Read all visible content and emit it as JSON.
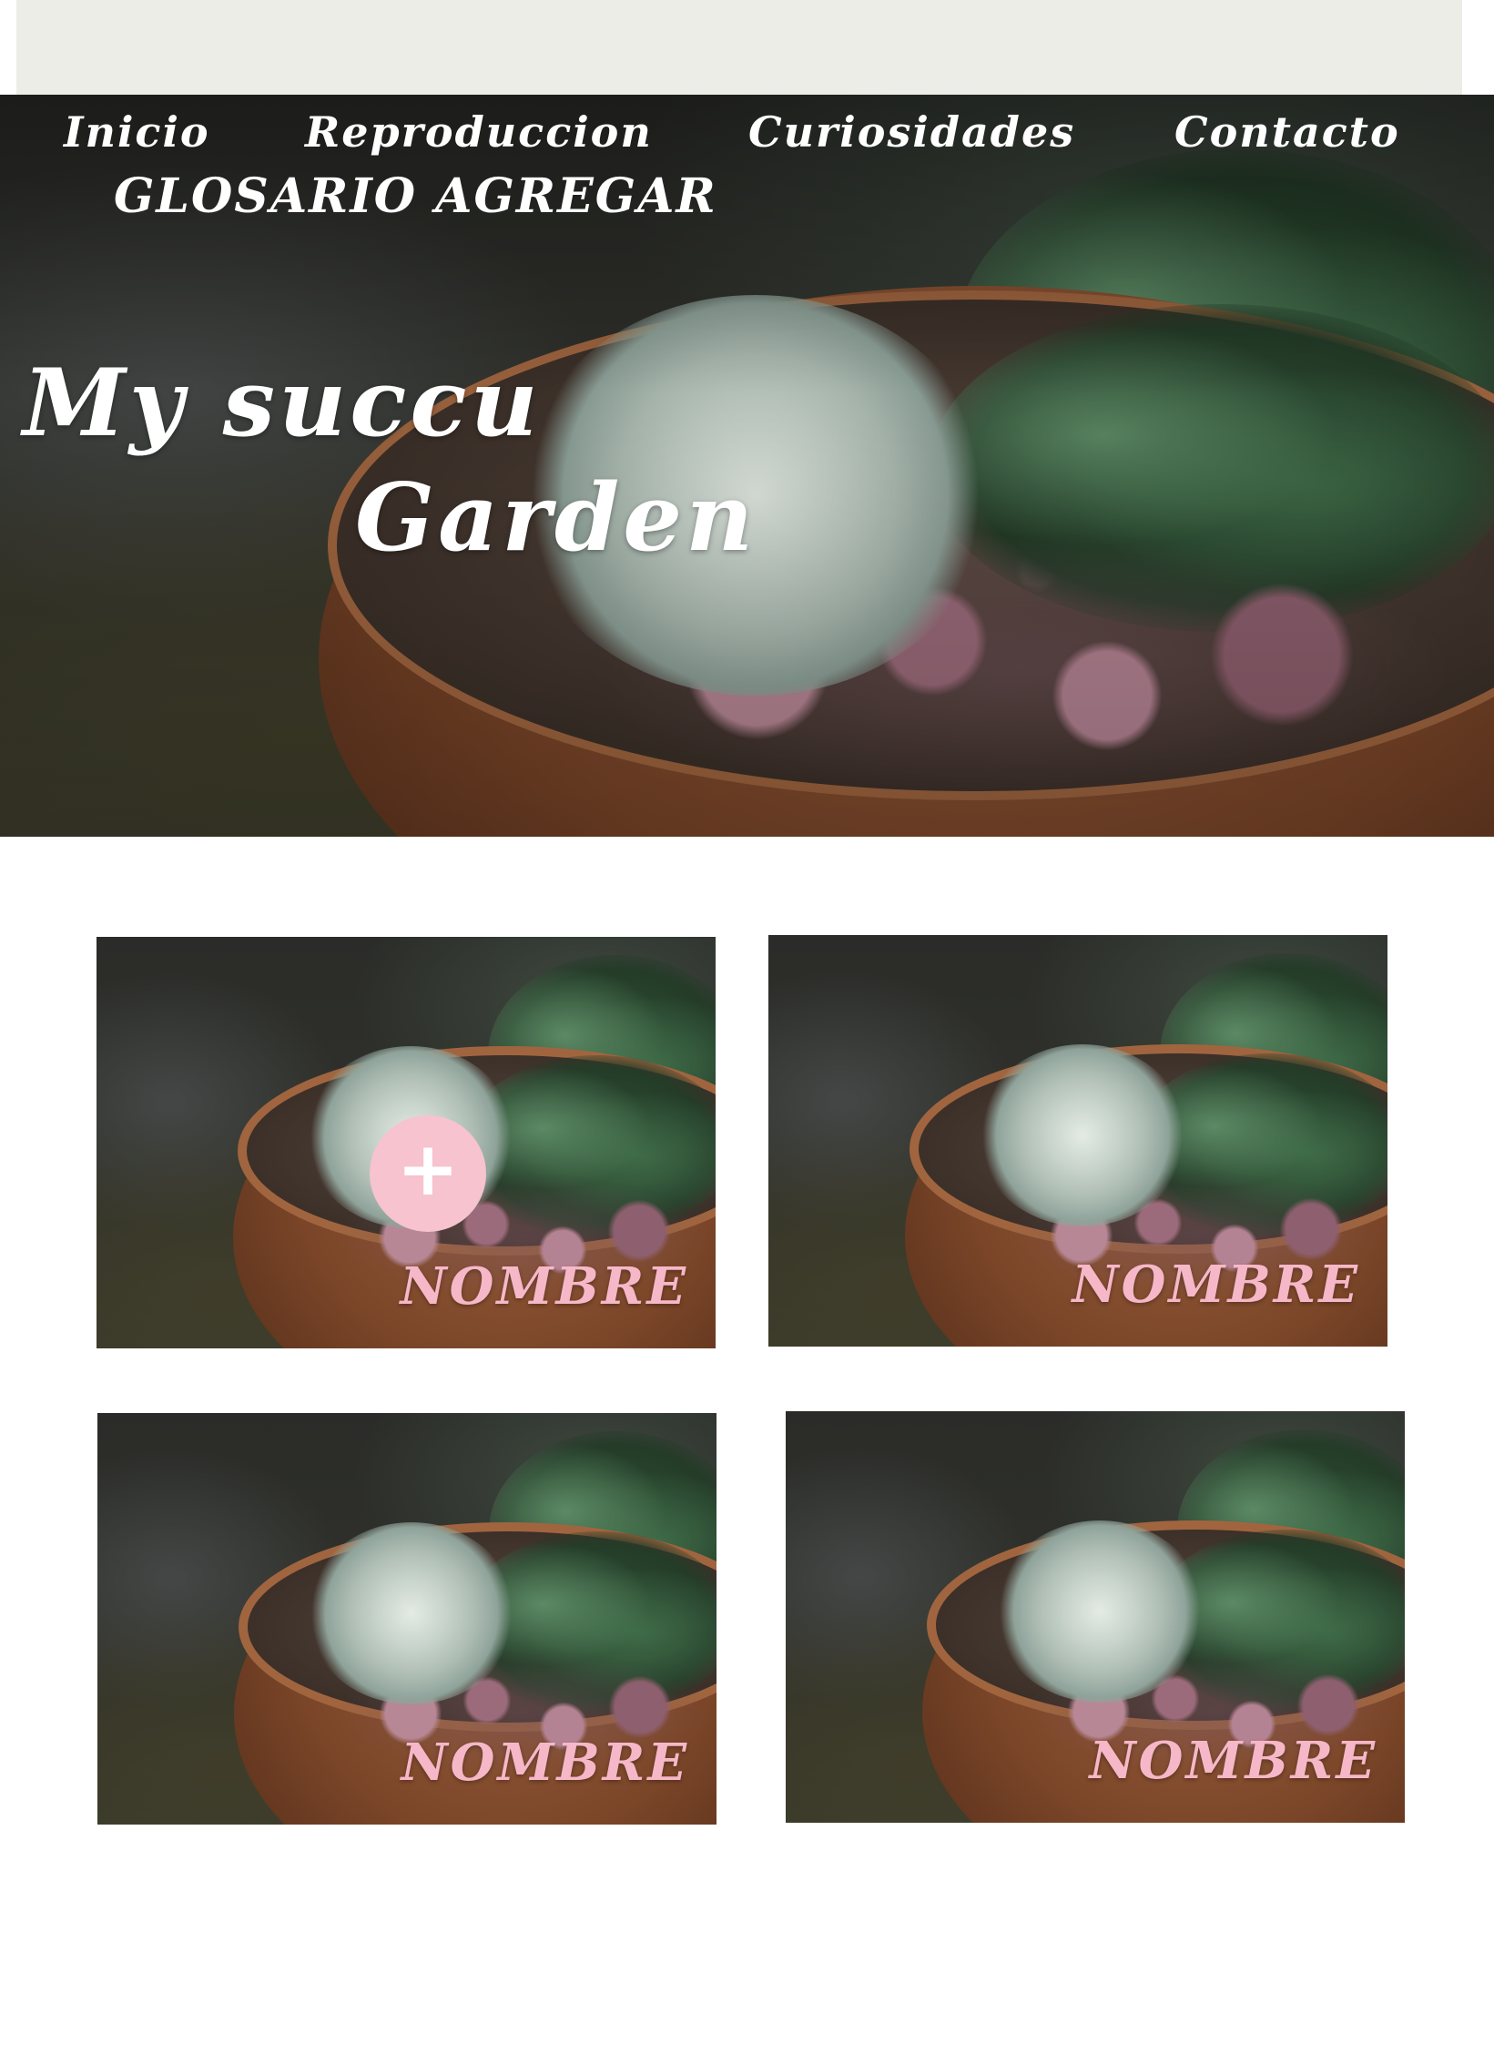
{
  "nav": {
    "items": [
      {
        "label": "Inicio"
      },
      {
        "label": "Reproduccion"
      },
      {
        "label": "Curiosidades"
      },
      {
        "label": "Contacto"
      },
      {
        "label": "GLOSARIO AGREGAR"
      }
    ]
  },
  "hero": {
    "title_line1": "My succu",
    "title_line2": "Garden"
  },
  "cards": [
    {
      "label": "NOMBRE",
      "add_button": "+"
    },
    {
      "label": "NOMBRE"
    },
    {
      "label": "NOMBRE"
    },
    {
      "label": "NOMBRE"
    }
  ],
  "colors": {
    "top_strip": "#edede8",
    "nav_text": "#ffffff",
    "card_label": "#f6b8c8",
    "add_button": "#f6c3cf"
  },
  "icons": {
    "add": "plus-icon"
  }
}
